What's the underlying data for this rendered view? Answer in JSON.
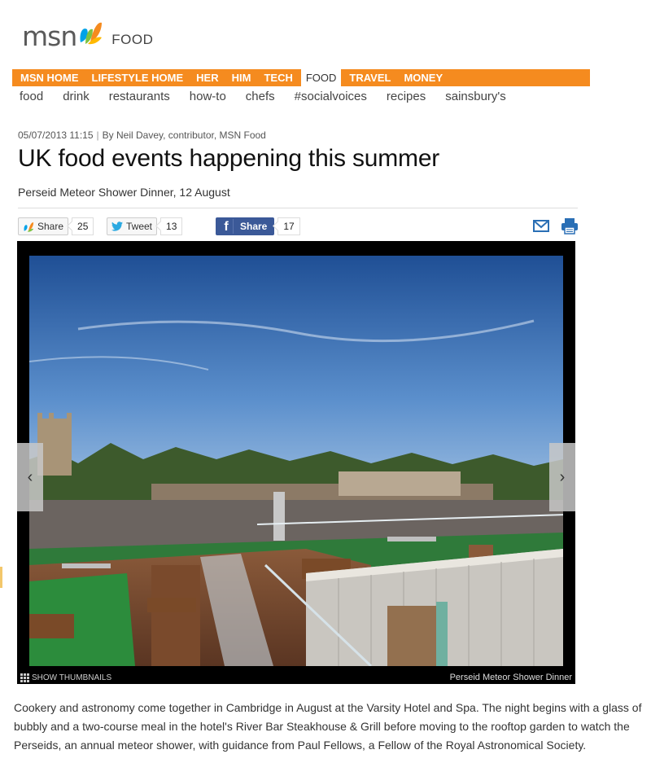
{
  "brand": {
    "logo_text": "msn",
    "section": "FOOD",
    "accent": "#f58b1f"
  },
  "nav": {
    "primary": [
      {
        "label": "MSN HOME"
      },
      {
        "label": "LIFESTYLE HOME"
      },
      {
        "label": "HER"
      },
      {
        "label": "HIM"
      },
      {
        "label": "TECH"
      },
      {
        "label": "FOOD",
        "active": true
      },
      {
        "label": "TRAVEL"
      },
      {
        "label": "MONEY"
      }
    ],
    "secondary": [
      {
        "label": "food"
      },
      {
        "label": "drink"
      },
      {
        "label": "restaurants"
      },
      {
        "label": "how-to"
      },
      {
        "label": "chefs"
      },
      {
        "label": "#socialvoices"
      },
      {
        "label": "recipes"
      },
      {
        "label": "sainsbury's"
      }
    ]
  },
  "article": {
    "timestamp": "05/07/2013 11:15",
    "byline": "By Neil Davey, contributor, MSN Food",
    "title": "UK food events happening this summer",
    "subtitle": "Perseid Meteor Shower Dinner, 12 August",
    "body": "Cookery and astronomy come together in Cambridge in August at the Varsity Hotel and Spa. The night begins with a glass of bubbly and a two-course meal in the hotel's River Bar Steakhouse & Grill before moving to the rooftop garden to watch the Perseids, an annual meteor shower, with guidance from Paul Fellows, a Fellow of the Royal Astronomical Society."
  },
  "share": {
    "msn": {
      "label": "Share",
      "count": "25",
      "icon": "msn-butterfly-icon"
    },
    "twitter": {
      "label": "Tweet",
      "count": "13",
      "icon": "twitter-bird-icon"
    },
    "facebook": {
      "label": "Share",
      "count": "17",
      "icon": "facebook-f-icon"
    },
    "email_icon": "email-icon",
    "print_icon": "print-icon"
  },
  "gallery": {
    "caption": "Perseid Meteor Shower Dinner",
    "thumbnails_label": "SHOW THUMBNAILS",
    "prev_label": "‹",
    "next_label": "›"
  }
}
